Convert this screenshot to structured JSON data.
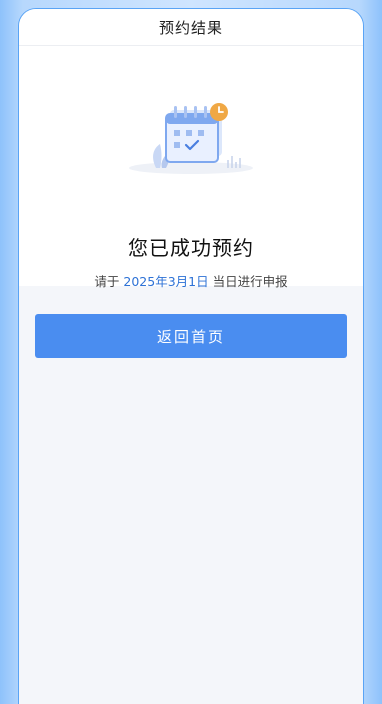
{
  "nav": {
    "title": "预约结果"
  },
  "result": {
    "title": "您已成功预约",
    "subtitle_prefix": "请于",
    "date": "2025年3月1日",
    "subtitle_suffix": "当日进行申报",
    "illustration_icon": "calendar-check-clock-icon"
  },
  "actions": {
    "home_label": "返回首页"
  },
  "colors": {
    "primary": "#4a8df0",
    "date_text": "#2e72d6",
    "clock_badge": "#f0a845",
    "background": "#f4f6fa"
  }
}
